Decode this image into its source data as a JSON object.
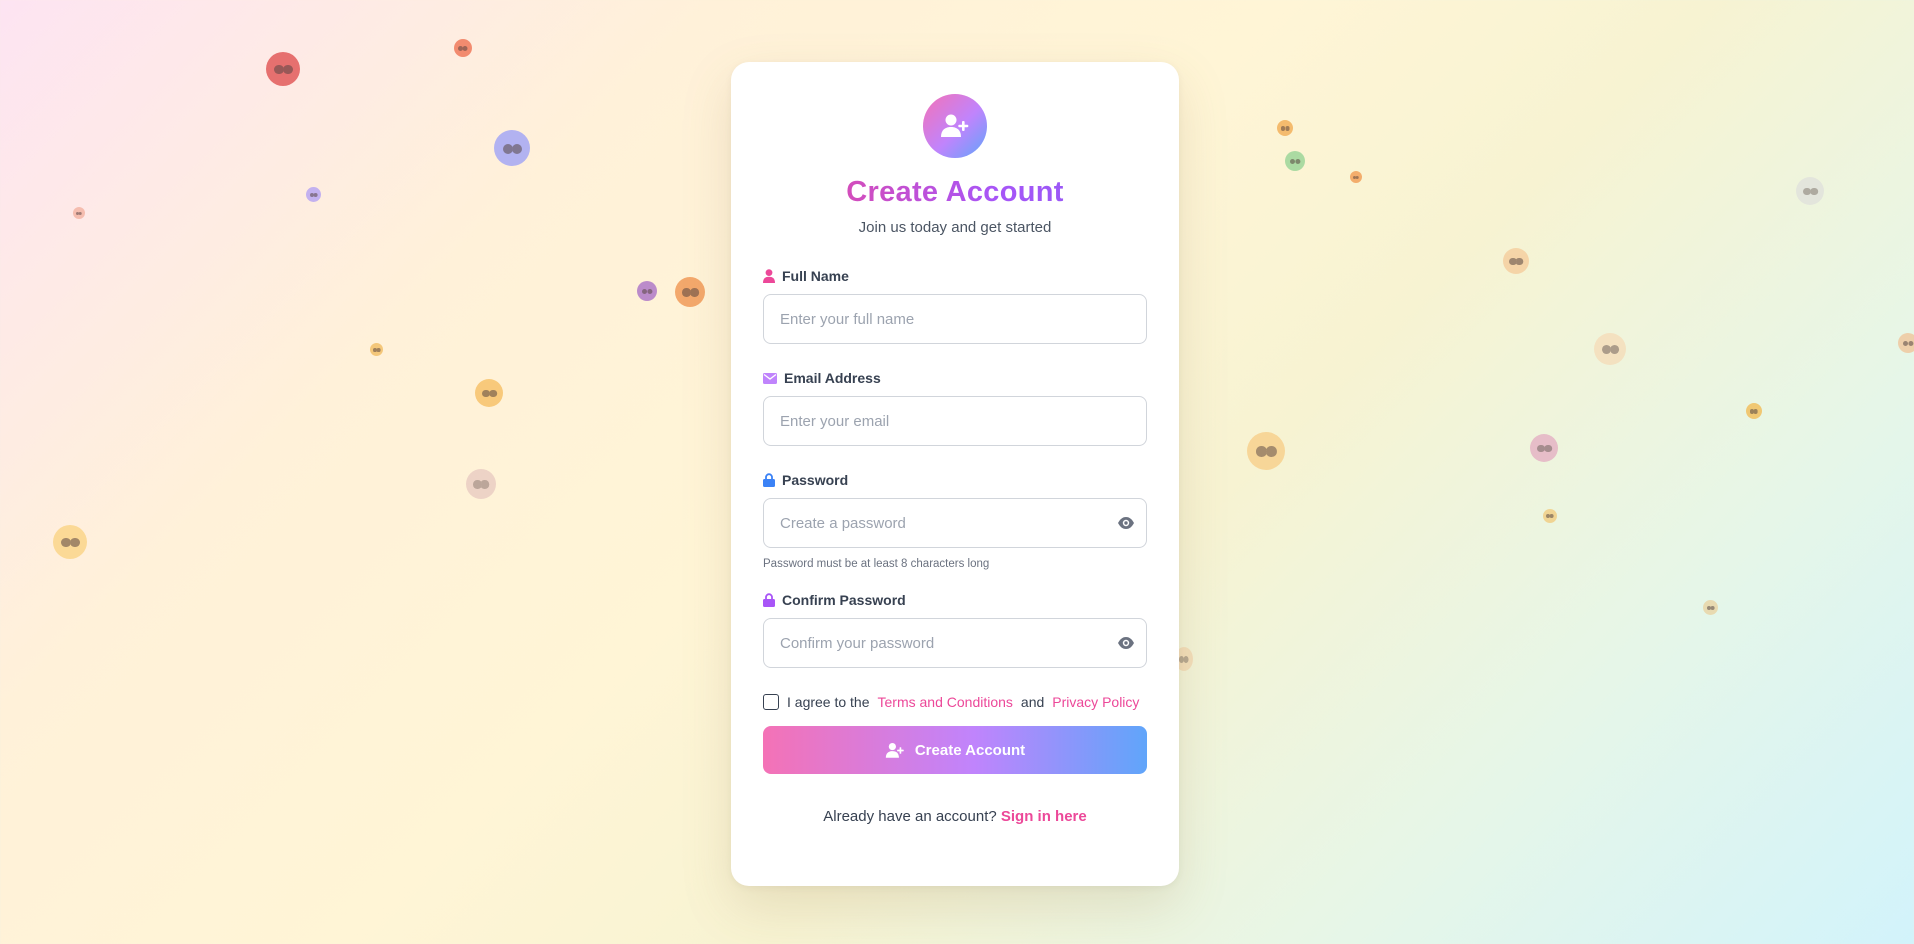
{
  "colors": {
    "accent_pink": "#ec4899",
    "accent_purple": "#a855f7",
    "accent_blue": "#60a5fa",
    "text": "#374151",
    "muted": "#6b7280"
  },
  "header": {
    "icon": "user-plus-icon",
    "title": "Create Account",
    "subtitle": "Join us today and get started"
  },
  "form": {
    "full_name": {
      "label": "Full Name",
      "icon": "user-icon",
      "placeholder": "Enter your full name",
      "value": ""
    },
    "email": {
      "label": "Email Address",
      "icon": "envelope-icon",
      "placeholder": "Enter your email",
      "value": ""
    },
    "password": {
      "label": "Password",
      "icon": "lock-icon",
      "placeholder": "Create a password",
      "value": "",
      "hint": "Password must be at least 8 characters long"
    },
    "confirm_password": {
      "label": "Confirm Password",
      "icon": "lock-icon",
      "placeholder": "Confirm your password",
      "value": ""
    },
    "agree": {
      "checked": false,
      "prefix": "I agree to the",
      "terms": "Terms and Conditions",
      "and": "and",
      "privacy": "Privacy Policy"
    },
    "submit_label": "Create Account"
  },
  "footer": {
    "prompt": "Already have an account?",
    "link": "Sign in here"
  },
  "background_emojis": [
    "angry-face",
    "pumpkin-face",
    "grimacing-face",
    "shocked-face",
    "small-face",
    "peach-face",
    "star-struck-face",
    "nail-polish-face",
    "smile-face",
    "screaming-face",
    "crying-face",
    "grinning-face",
    "cookie-face",
    "alien-face",
    "rainbow",
    "skull",
    "laughing-face",
    "dizzy-face",
    "wink-face",
    "star",
    "smiling-face",
    "flower-face",
    "coin-face",
    "partial-face"
  ]
}
